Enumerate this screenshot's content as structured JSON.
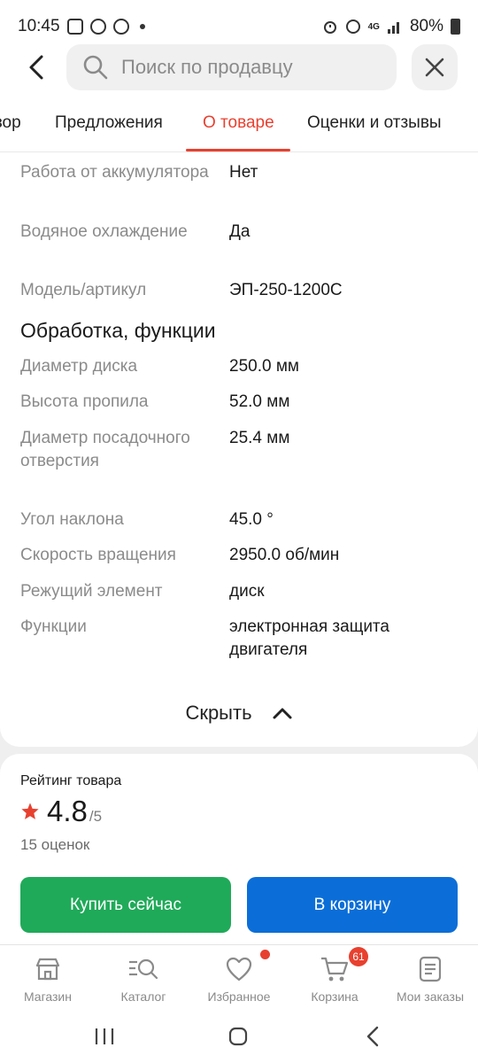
{
  "status_bar": {
    "time": "10:45",
    "battery": "80%",
    "network": "4G"
  },
  "search": {
    "placeholder": "Поиск по продавцу"
  },
  "tabs": [
    {
      "label": "зор"
    },
    {
      "label": "Предложения"
    },
    {
      "label": "О товаре",
      "active": true
    },
    {
      "label": "Оценки и отзывы"
    }
  ],
  "specs_top": [
    {
      "key": "Работа от аккумулятора",
      "value": "Нет"
    },
    {
      "key": "Водяное охлаждение",
      "value": "Да"
    },
    {
      "key": "Модель/артикул",
      "value": "ЭП-250-1200С"
    }
  ],
  "section": {
    "title": "Обработка, функции"
  },
  "specs_bottom": [
    {
      "key": "Диаметр диска",
      "value": "250.0 мм"
    },
    {
      "key": "Высота пропила",
      "value": "52.0 мм"
    },
    {
      "key": "Диаметр посадочного отверстия",
      "value": "25.4 мм"
    },
    {
      "key": "Угол наклона",
      "value": "45.0 °"
    },
    {
      "key": "Скорость вращения",
      "value": "2950.0 об/мин"
    },
    {
      "key": "Режущий элемент",
      "value": "диск"
    },
    {
      "key": "Функции",
      "value": "электронная защита двигателя"
    }
  ],
  "hide_label": "Скрыть",
  "rating": {
    "title": "Рейтинг товара",
    "value": "4.8",
    "max": "/5",
    "count": "15 оценок"
  },
  "actions": {
    "buy": "Купить сейчас",
    "cart": "В корзину"
  },
  "bottom_nav": [
    {
      "label": "Магазин",
      "icon": "store-icon"
    },
    {
      "label": "Каталог",
      "icon": "catalog-search-icon"
    },
    {
      "label": "Избранное",
      "icon": "heart-icon"
    },
    {
      "label": "Корзина",
      "icon": "cart-icon",
      "badge": "61"
    },
    {
      "label": "Мои заказы",
      "icon": "orders-icon"
    }
  ],
  "colors": {
    "accent": "#e8402f",
    "buy": "#1faa59",
    "cart": "#0b6ed8"
  }
}
